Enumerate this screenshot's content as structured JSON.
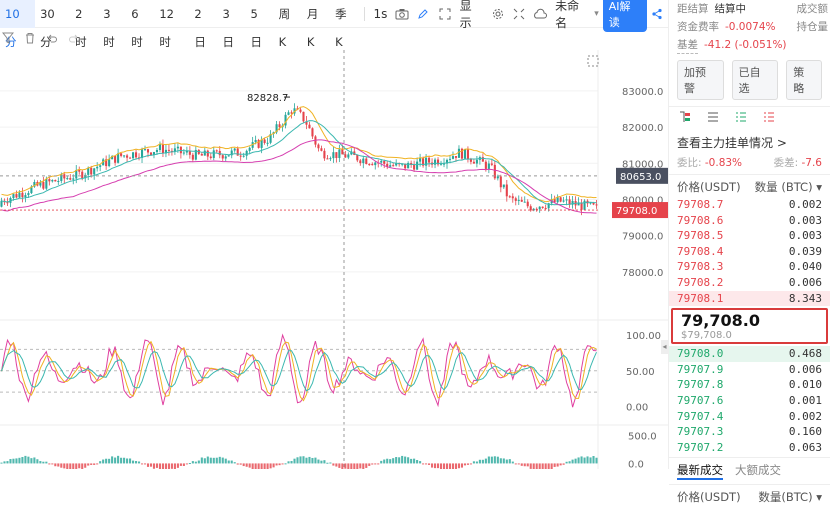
{
  "toolbar": {
    "timeframes": [
      "10分",
      "30分",
      "2时",
      "3时",
      "6时",
      "12时",
      "2日",
      "3日",
      "5日",
      "周K",
      "月K",
      "季K"
    ],
    "active_timeframe": "10分",
    "interval_label": "1s",
    "display_label": "显示",
    "layout_label": "未命名",
    "ai_label": "AI解读"
  },
  "chart": {
    "price_axis": [
      "83000.0",
      "82000.0",
      "81000.0",
      "80000.0",
      "79000.0",
      "78000.0"
    ],
    "osc_axis": [
      "100.00",
      "50.00",
      "0.00"
    ],
    "macd_axis": [
      "500.0",
      "0.0"
    ],
    "high_label": "82828.7",
    "crosshair_price": "80653.0",
    "last_price_tag": "79708.0",
    "colors": {
      "up": "#26a69a",
      "down": "#e5434b",
      "ma_yellow": "#f0b323",
      "ma_teal": "#3bb8b0",
      "ma_magenta": "#d63fb0",
      "k_line": "#e040a0",
      "d_line": "#f0b323"
    }
  },
  "info": {
    "row1_label": "距结算",
    "row1_value": "结算中",
    "row1_right": "成交额",
    "row2_label": "资金费率",
    "row2_value": "-0.0074%",
    "row2_right": "持仓量",
    "row3_label": "基差",
    "row3_value": "-41.2 (-0.051%)"
  },
  "buttons": [
    "加预警",
    "已自选",
    "策略"
  ],
  "depth_link": "查看主力挂单情况 >",
  "ratio": {
    "left_label": "委比:",
    "left_value": "-0.83%",
    "right_label": "委差:",
    "right_value": "-7.6"
  },
  "orderbook": {
    "head_price": "价格(USDT)",
    "head_qty": "数量 (BTC) ▾",
    "asks": [
      [
        "79708.7",
        "0.002"
      ],
      [
        "79708.6",
        "0.003"
      ],
      [
        "79708.5",
        "0.003"
      ],
      [
        "79708.4",
        "0.039"
      ],
      [
        "79708.3",
        "0.040"
      ],
      [
        "79708.2",
        "0.006"
      ],
      [
        "79708.1",
        "8.343"
      ]
    ],
    "last_price": "79,708.0",
    "last_sub": "$79,708.0",
    "bids": [
      [
        "79708.0",
        "0.468"
      ],
      [
        "79707.9",
        "0.006"
      ],
      [
        "79707.8",
        "0.010"
      ],
      [
        "79707.6",
        "0.001"
      ],
      [
        "79707.4",
        "0.002"
      ],
      [
        "79707.3",
        "0.160"
      ],
      [
        "79707.2",
        "0.063"
      ]
    ]
  },
  "trades": {
    "tab1": "最新成交",
    "tab2": "大额成交",
    "head_price": "价格(USDT)",
    "head_qty": "数量(BTC) ▾"
  }
}
